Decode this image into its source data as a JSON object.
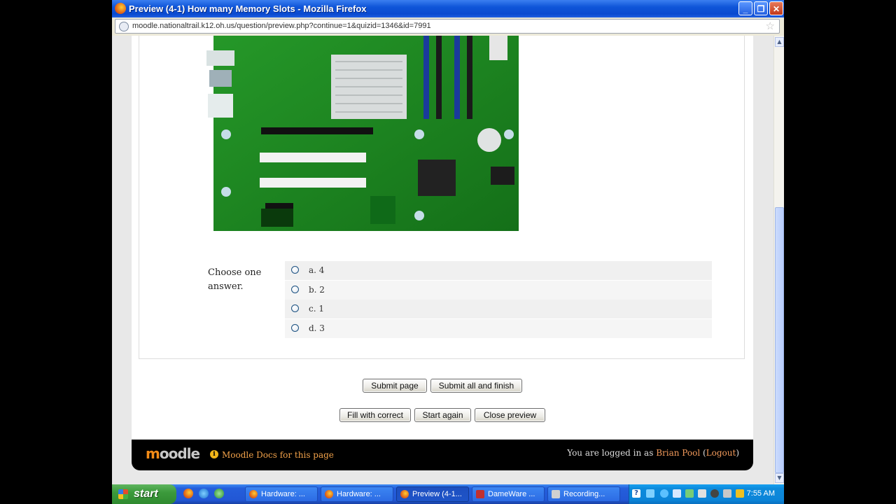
{
  "window": {
    "title": "Preview (4-1) How many Memory Slots - Mozilla Firefox",
    "minimize_glyph": "_",
    "maximize_glyph": "❐",
    "close_glyph": "✕"
  },
  "address_bar": {
    "url": "moodle.nationaltrail.k12.oh.us/question/preview.php?continue=1&quizid=1346&id=7991"
  },
  "question": {
    "prompt_label": "Choose one answer.",
    "answers": [
      {
        "label": "a. 4"
      },
      {
        "label": "b. 2"
      },
      {
        "label": "c. 1"
      },
      {
        "label": "d. 3"
      }
    ]
  },
  "buttons": {
    "submit_page": "Submit page",
    "submit_all": "Submit all and finish",
    "fill_correct": "Fill with correct",
    "start_again": "Start again",
    "close_preview": "Close preview"
  },
  "footer": {
    "logo_prefix": "m",
    "logo_rest": "oodle",
    "docs_link": "Moodle Docs for this page",
    "logged_in_prefix": "You are logged in as ",
    "user_name": "Brian Pool",
    "logout_open": " (",
    "logout_label": "Logout",
    "logout_close": ")"
  },
  "taskbar": {
    "start_label": "start",
    "tasks": [
      {
        "label": "Hardware: ...",
        "icon": "firefox-icon"
      },
      {
        "label": "Hardware: ...",
        "icon": "firefox-icon"
      },
      {
        "label": "Preview (4-1...",
        "icon": "firefox-icon",
        "active": true
      },
      {
        "label": "DameWare ...",
        "icon": "dameware-icon"
      },
      {
        "label": "Recording...",
        "icon": "recording-icon"
      }
    ],
    "clock": "7:55 AM"
  }
}
